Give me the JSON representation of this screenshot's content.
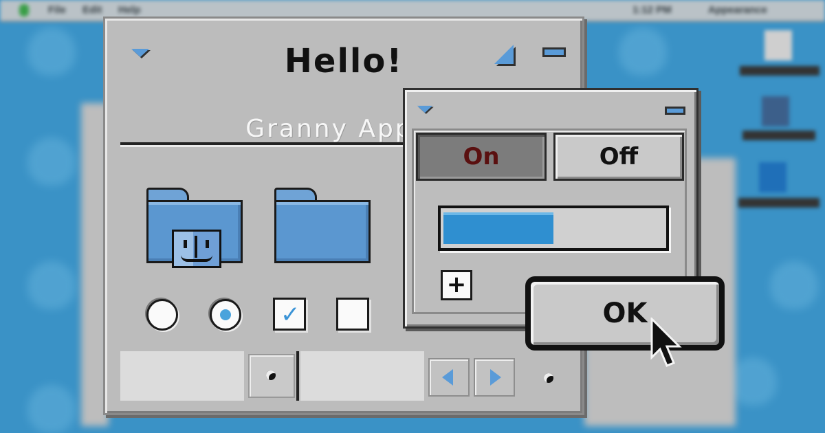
{
  "menubar": {
    "items": [
      "File",
      "Edit",
      "Help"
    ],
    "clock": "1:12 PM",
    "app_name": "Appearance"
  },
  "main_window": {
    "title": "Hello!",
    "subtitle": "Granny Apple",
    "icons": [
      "finder-folder-icon",
      "folder-icon"
    ],
    "controls": {
      "radio_unselected": false,
      "radio_selected": true,
      "checkbox_checked": true,
      "checkbox_unchecked": false
    }
  },
  "small_window": {
    "toggle_on_label": "On",
    "toggle_off_label": "Off",
    "progress_fraction": 0.5,
    "add_label": "+"
  },
  "ok_button": {
    "label": "OK"
  },
  "colors": {
    "accent": "#5a9bd8",
    "desktop": "#3a92c6",
    "window_face": "#bcbcbc",
    "progress_fill": "#2f8fd0",
    "on_text": "#5a1010"
  }
}
